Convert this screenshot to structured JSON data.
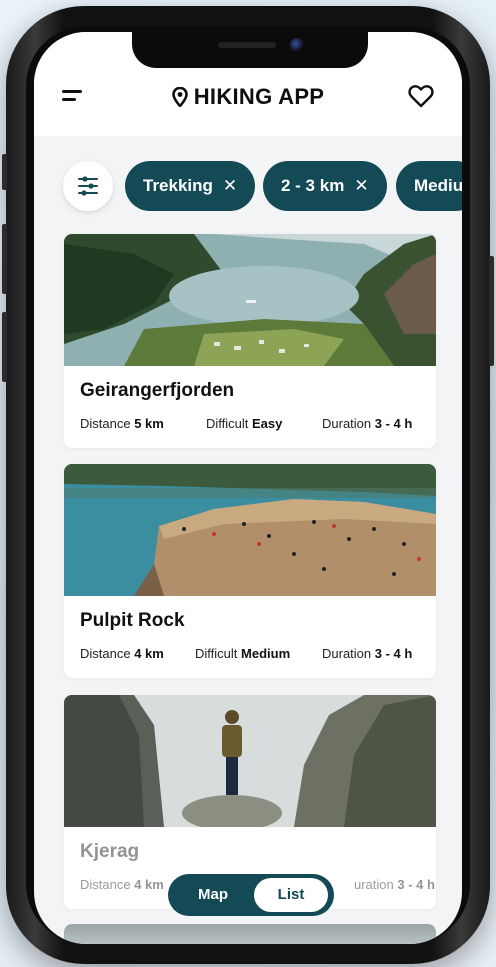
{
  "header": {
    "title": "HIKING APP",
    "menu_icon": "hamburger-icon",
    "location_icon": "location-pin-icon",
    "favorite_icon": "heart-outline-icon"
  },
  "filters": {
    "settings_icon": "sliders-icon",
    "chips": [
      {
        "label": "Trekking",
        "remove": "✕"
      },
      {
        "label": "2 - 3 km",
        "remove": "✕"
      },
      {
        "label": "Mediu"
      }
    ]
  },
  "cards": [
    {
      "name": "Geirangerfjorden",
      "distance_label": "Distance",
      "distance": "5 km",
      "difficulty_label": "Difficult",
      "difficulty": "Easy",
      "duration_label": "Duration",
      "duration": "3 - 4 h"
    },
    {
      "name": "Pulpit Rock",
      "distance_label": "Distance",
      "distance": "4 km",
      "difficulty_label": "Difficult",
      "difficulty": "Medium",
      "duration_label": "Duration",
      "duration": "3 - 4 h"
    },
    {
      "name": "Kjerag",
      "distance_label": "Distance",
      "distance": "4 km",
      "duration_label": "uration",
      "duration": "3 - 4 h"
    }
  ],
  "view_toggle": {
    "map": "Map",
    "list": "List",
    "selected": "List"
  },
  "colors": {
    "accent": "#134a56",
    "background": "#f3f4f6",
    "card": "#ffffff"
  }
}
